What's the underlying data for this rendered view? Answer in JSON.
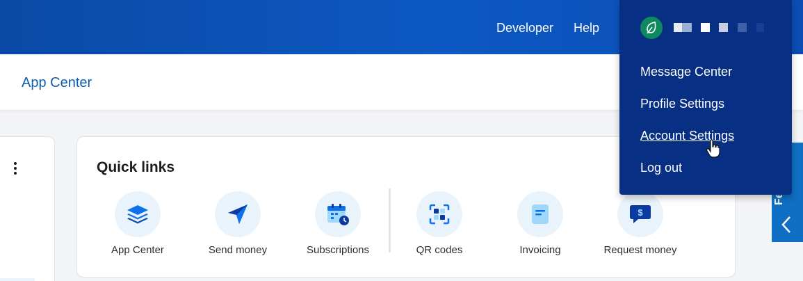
{
  "topbar": {
    "developer_label": "Developer",
    "help_label": "Help"
  },
  "subbar": {
    "app_center_label": "App Center"
  },
  "quick_links": {
    "title": "Quick links",
    "items": [
      {
        "label": "App Center",
        "icon": "layers-icon"
      },
      {
        "label": "Send money",
        "icon": "paper-plane-icon"
      },
      {
        "label": "Subscriptions",
        "icon": "calendar-clock-icon"
      },
      {
        "label": "QR codes",
        "icon": "qr-code-icon"
      },
      {
        "label": "Invoicing",
        "icon": "invoice-icon"
      },
      {
        "label": "Request money",
        "icon": "money-request-icon"
      }
    ]
  },
  "feedback": {
    "label": "Feedback"
  },
  "account_menu": {
    "avatar_icon": "leaf-avatar-icon",
    "items": [
      {
        "label": "Message Center"
      },
      {
        "label": "Profile Settings"
      },
      {
        "label": "Account Settings",
        "hovered": true
      },
      {
        "label": "Log out"
      }
    ]
  },
  "colors": {
    "brand_blue": "#0d58c2",
    "menu_navy": "#072f84",
    "link_blue": "#0d5dad",
    "icon_blue": "#1072eb",
    "icon_light_blue": "#9fd8fb",
    "avatar_green": "#0f8a5f"
  }
}
